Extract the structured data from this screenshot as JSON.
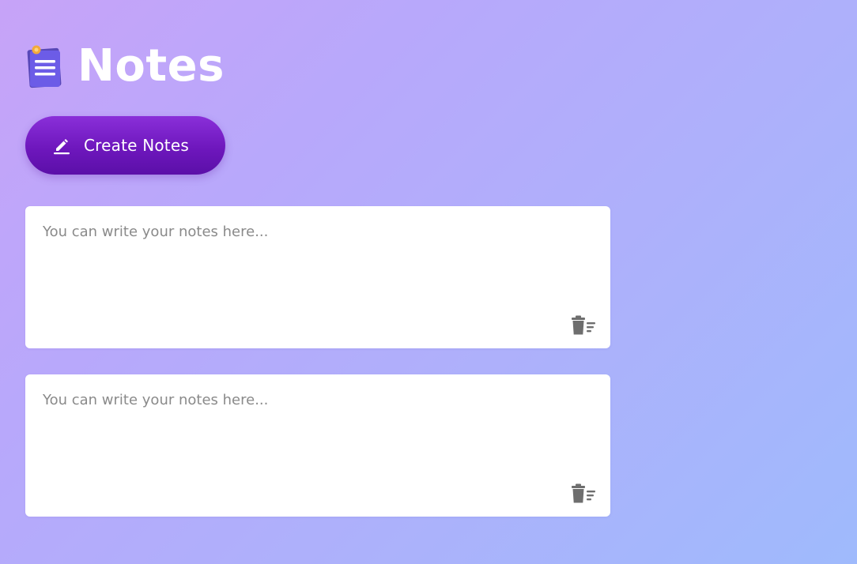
{
  "header": {
    "title": "Notes",
    "logo_icon": "notepad-icon"
  },
  "toolbar": {
    "create_label": "Create Notes",
    "create_icon": "pencil-icon",
    "button_color": "#6e17bd"
  },
  "notes": [
    {
      "placeholder": "You can write your notes here...",
      "value": "",
      "delete_icon": "trash-icon"
    },
    {
      "placeholder": "You can write your notes here...",
      "value": "",
      "delete_icon": "trash-icon"
    }
  ],
  "colors": {
    "background_start": "#c7a3f8",
    "background_end": "#9fbafc",
    "card": "#ffffff",
    "icon_gray": "#6e6e6e"
  }
}
